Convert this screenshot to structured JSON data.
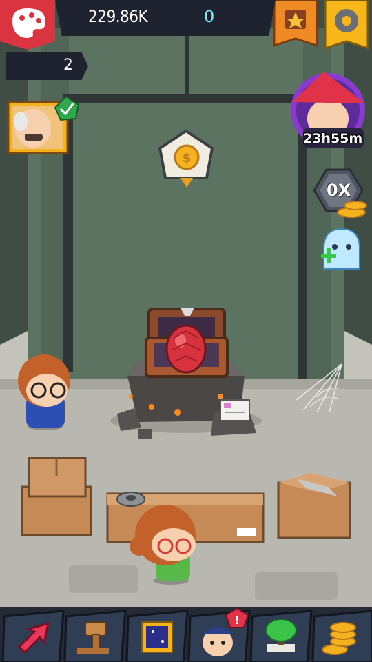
{
  "top_bar": {
    "coins": "229.86K",
    "gems": "0",
    "level": "2"
  },
  "right_side": {
    "event_timer": "23h55m",
    "multiplier": "0X"
  },
  "bottom_nav": [
    {
      "name": "upgrade-arrow-icon"
    },
    {
      "name": "hammer-icon"
    },
    {
      "name": "framed-picture-icon"
    },
    {
      "name": "police-character-icon",
      "alert": "!"
    },
    {
      "name": "bonsai-tree-icon"
    },
    {
      "name": "coin-stack-icon"
    }
  ],
  "colors": {
    "bg_wall": "#5d7362",
    "floor": "#b9b8b0",
    "top_bar": "#1f2330",
    "orange_ribbon": "#f08a24",
    "yellow_ribbon": "#f7b71a",
    "egg": "#d8323e"
  }
}
